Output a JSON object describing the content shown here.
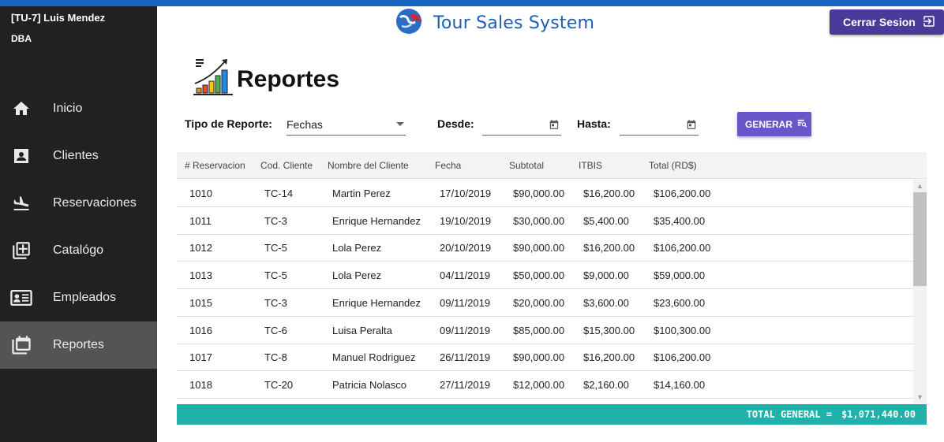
{
  "user": {
    "name": "[TU-7] Luis Mendez",
    "role": "DBA"
  },
  "nav": [
    {
      "label": "Inicio",
      "icon": "home-icon"
    },
    {
      "label": "Clientes",
      "icon": "contact-card-icon"
    },
    {
      "label": "Reservaciones",
      "icon": "flight-land-icon"
    },
    {
      "label": "Catalógo",
      "icon": "library-add-icon"
    },
    {
      "label": "Empleados",
      "icon": "badge-icon"
    },
    {
      "label": "Reportes",
      "icon": "calendar-report-icon",
      "active": true
    }
  ],
  "header": {
    "title": "Tour Sales System",
    "logout_label": "Cerrar Sesion"
  },
  "page": {
    "title": "Reportes"
  },
  "filters": {
    "tipo_label": "Tipo de Reporte:",
    "tipo_value": "Fechas",
    "desde_label": "Desde:",
    "hasta_label": "Hasta:",
    "generate_label": "GENERAR"
  },
  "table": {
    "columns": [
      "# Reservacion",
      "Cod. Cliente",
      "Nombre del Cliente",
      "Fecha",
      "Subtotal",
      "ITBIS",
      "Total (RD$)"
    ],
    "rows": [
      [
        "1010",
        "TC-14",
        "Martin Perez",
        "17/10/2019",
        "$90,000.00",
        "$16,200.00",
        "$106,200.00"
      ],
      [
        "1011",
        "TC-3",
        "Enrique Hernandez",
        "19/10/2019",
        "$30,000.00",
        "$5,400.00",
        "$35,400.00"
      ],
      [
        "1012",
        "TC-5",
        "Lola Perez",
        "20/10/2019",
        "$90,000.00",
        "$16,200.00",
        "$106,200.00"
      ],
      [
        "1013",
        "TC-5",
        "Lola Perez",
        "04/11/2019",
        "$50,000.00",
        "$9,000.00",
        "$59,000.00"
      ],
      [
        "1015",
        "TC-3",
        "Enrique Hernandez",
        "09/11/2019",
        "$20,000.00",
        "$3,600.00",
        "$23,600.00"
      ],
      [
        "1016",
        "TC-6",
        "Luisa Peralta",
        "09/11/2019",
        "$85,000.00",
        "$15,300.00",
        "$100,300.00"
      ],
      [
        "1017",
        "TC-8",
        "Manuel Rodriguez",
        "26/11/2019",
        "$90,000.00",
        "$16,200.00",
        "$106,200.00"
      ],
      [
        "1018",
        "TC-20",
        "Patricia Nolasco",
        "27/11/2019",
        "$12,000.00",
        "$2,160.00",
        "$14,160.00"
      ]
    ]
  },
  "total": {
    "label": "TOTAL GENERAL =",
    "amount": "$1,071,440.00"
  },
  "colors": {
    "accent": "#1565c0",
    "sidebar": "#212121",
    "button": "#6a55c9",
    "total_bar": "#20b2aa"
  }
}
